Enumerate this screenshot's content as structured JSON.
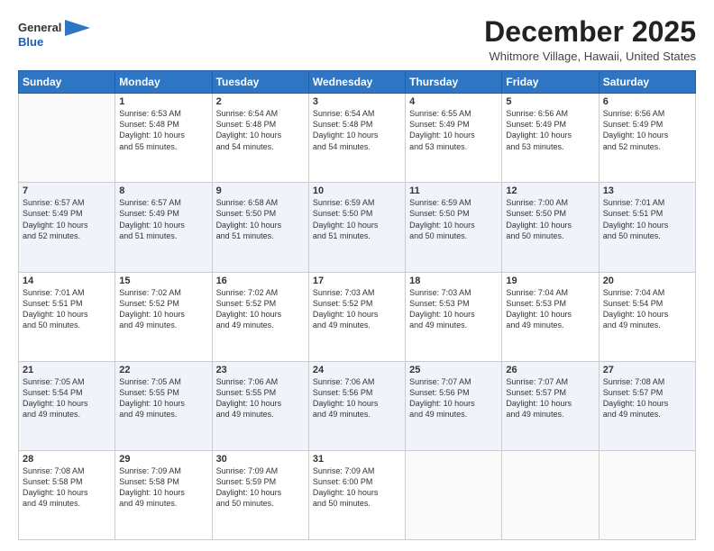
{
  "header": {
    "logo_general": "General",
    "logo_blue": "Blue",
    "month_title": "December 2025",
    "location": "Whitmore Village, Hawaii, United States"
  },
  "days_of_week": [
    "Sunday",
    "Monday",
    "Tuesday",
    "Wednesday",
    "Thursday",
    "Friday",
    "Saturday"
  ],
  "weeks": [
    [
      {
        "day": "",
        "info": ""
      },
      {
        "day": "1",
        "info": "Sunrise: 6:53 AM\nSunset: 5:48 PM\nDaylight: 10 hours\nand 55 minutes."
      },
      {
        "day": "2",
        "info": "Sunrise: 6:54 AM\nSunset: 5:48 PM\nDaylight: 10 hours\nand 54 minutes."
      },
      {
        "day": "3",
        "info": "Sunrise: 6:54 AM\nSunset: 5:48 PM\nDaylight: 10 hours\nand 54 minutes."
      },
      {
        "day": "4",
        "info": "Sunrise: 6:55 AM\nSunset: 5:49 PM\nDaylight: 10 hours\nand 53 minutes."
      },
      {
        "day": "5",
        "info": "Sunrise: 6:56 AM\nSunset: 5:49 PM\nDaylight: 10 hours\nand 53 minutes."
      },
      {
        "day": "6",
        "info": "Sunrise: 6:56 AM\nSunset: 5:49 PM\nDaylight: 10 hours\nand 52 minutes."
      }
    ],
    [
      {
        "day": "7",
        "info": "Sunrise: 6:57 AM\nSunset: 5:49 PM\nDaylight: 10 hours\nand 52 minutes."
      },
      {
        "day": "8",
        "info": "Sunrise: 6:57 AM\nSunset: 5:49 PM\nDaylight: 10 hours\nand 51 minutes."
      },
      {
        "day": "9",
        "info": "Sunrise: 6:58 AM\nSunset: 5:50 PM\nDaylight: 10 hours\nand 51 minutes."
      },
      {
        "day": "10",
        "info": "Sunrise: 6:59 AM\nSunset: 5:50 PM\nDaylight: 10 hours\nand 51 minutes."
      },
      {
        "day": "11",
        "info": "Sunrise: 6:59 AM\nSunset: 5:50 PM\nDaylight: 10 hours\nand 50 minutes."
      },
      {
        "day": "12",
        "info": "Sunrise: 7:00 AM\nSunset: 5:50 PM\nDaylight: 10 hours\nand 50 minutes."
      },
      {
        "day": "13",
        "info": "Sunrise: 7:01 AM\nSunset: 5:51 PM\nDaylight: 10 hours\nand 50 minutes."
      }
    ],
    [
      {
        "day": "14",
        "info": "Sunrise: 7:01 AM\nSunset: 5:51 PM\nDaylight: 10 hours\nand 50 minutes."
      },
      {
        "day": "15",
        "info": "Sunrise: 7:02 AM\nSunset: 5:52 PM\nDaylight: 10 hours\nand 49 minutes."
      },
      {
        "day": "16",
        "info": "Sunrise: 7:02 AM\nSunset: 5:52 PM\nDaylight: 10 hours\nand 49 minutes."
      },
      {
        "day": "17",
        "info": "Sunrise: 7:03 AM\nSunset: 5:52 PM\nDaylight: 10 hours\nand 49 minutes."
      },
      {
        "day": "18",
        "info": "Sunrise: 7:03 AM\nSunset: 5:53 PM\nDaylight: 10 hours\nand 49 minutes."
      },
      {
        "day": "19",
        "info": "Sunrise: 7:04 AM\nSunset: 5:53 PM\nDaylight: 10 hours\nand 49 minutes."
      },
      {
        "day": "20",
        "info": "Sunrise: 7:04 AM\nSunset: 5:54 PM\nDaylight: 10 hours\nand 49 minutes."
      }
    ],
    [
      {
        "day": "21",
        "info": "Sunrise: 7:05 AM\nSunset: 5:54 PM\nDaylight: 10 hours\nand 49 minutes."
      },
      {
        "day": "22",
        "info": "Sunrise: 7:05 AM\nSunset: 5:55 PM\nDaylight: 10 hours\nand 49 minutes."
      },
      {
        "day": "23",
        "info": "Sunrise: 7:06 AM\nSunset: 5:55 PM\nDaylight: 10 hours\nand 49 minutes."
      },
      {
        "day": "24",
        "info": "Sunrise: 7:06 AM\nSunset: 5:56 PM\nDaylight: 10 hours\nand 49 minutes."
      },
      {
        "day": "25",
        "info": "Sunrise: 7:07 AM\nSunset: 5:56 PM\nDaylight: 10 hours\nand 49 minutes."
      },
      {
        "day": "26",
        "info": "Sunrise: 7:07 AM\nSunset: 5:57 PM\nDaylight: 10 hours\nand 49 minutes."
      },
      {
        "day": "27",
        "info": "Sunrise: 7:08 AM\nSunset: 5:57 PM\nDaylight: 10 hours\nand 49 minutes."
      }
    ],
    [
      {
        "day": "28",
        "info": "Sunrise: 7:08 AM\nSunset: 5:58 PM\nDaylight: 10 hours\nand 49 minutes."
      },
      {
        "day": "29",
        "info": "Sunrise: 7:09 AM\nSunset: 5:58 PM\nDaylight: 10 hours\nand 49 minutes."
      },
      {
        "day": "30",
        "info": "Sunrise: 7:09 AM\nSunset: 5:59 PM\nDaylight: 10 hours\nand 50 minutes."
      },
      {
        "day": "31",
        "info": "Sunrise: 7:09 AM\nSunset: 6:00 PM\nDaylight: 10 hours\nand 50 minutes."
      },
      {
        "day": "",
        "info": ""
      },
      {
        "day": "",
        "info": ""
      },
      {
        "day": "",
        "info": ""
      }
    ]
  ]
}
